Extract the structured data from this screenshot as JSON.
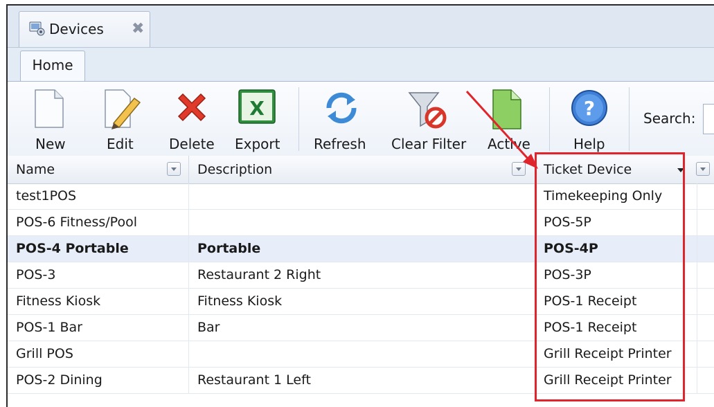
{
  "window": {
    "doc_tab": {
      "label": "Devices"
    },
    "ribbon_tab": {
      "label": "Home"
    }
  },
  "toolbar": {
    "new": "New",
    "edit": "Edit",
    "delete": "Delete",
    "export": "Export",
    "refresh": "Refresh",
    "clear_filter": "Clear Filter",
    "active": "Active",
    "help": "Help",
    "search_label": "Search:",
    "search_value": ""
  },
  "grid": {
    "columns": [
      "Name",
      "Description",
      "Ticket Device"
    ],
    "rows": [
      {
        "name": "test1POS",
        "description": "",
        "ticket_device": "Timekeeping Only"
      },
      {
        "name": "POS-6 Fitness/Pool",
        "description": "",
        "ticket_device": "POS-5P"
      },
      {
        "name": "POS-4 Portable",
        "description": "Portable",
        "ticket_device": "POS-4P",
        "selected": true
      },
      {
        "name": "POS-3",
        "description": "Restaurant 2 Right",
        "ticket_device": "POS-3P"
      },
      {
        "name": "Fitness Kiosk",
        "description": "Fitness Kiosk",
        "ticket_device": "POS-1 Receipt"
      },
      {
        "name": "POS-1 Bar",
        "description": "Bar",
        "ticket_device": "POS-1 Receipt"
      },
      {
        "name": "Grill POS",
        "description": "",
        "ticket_device": "Grill Receipt Printer"
      },
      {
        "name": "POS-2 Dining",
        "description": "Restaurant 1 Left",
        "ticket_device": "Grill Receipt Printer"
      }
    ]
  },
  "icons": {
    "doc_tab": "devices-icon",
    "close": "close-icon",
    "new": "new-document-icon",
    "edit": "edit-pencil-icon",
    "delete": "delete-x-icon",
    "export": "excel-icon",
    "refresh": "refresh-icon",
    "clear_filter": "clear-filter-icon",
    "active": "active-document-icon",
    "help": "help-icon"
  },
  "colors": {
    "annotation": "#e0242c",
    "selected_row": "#e7eefa"
  }
}
